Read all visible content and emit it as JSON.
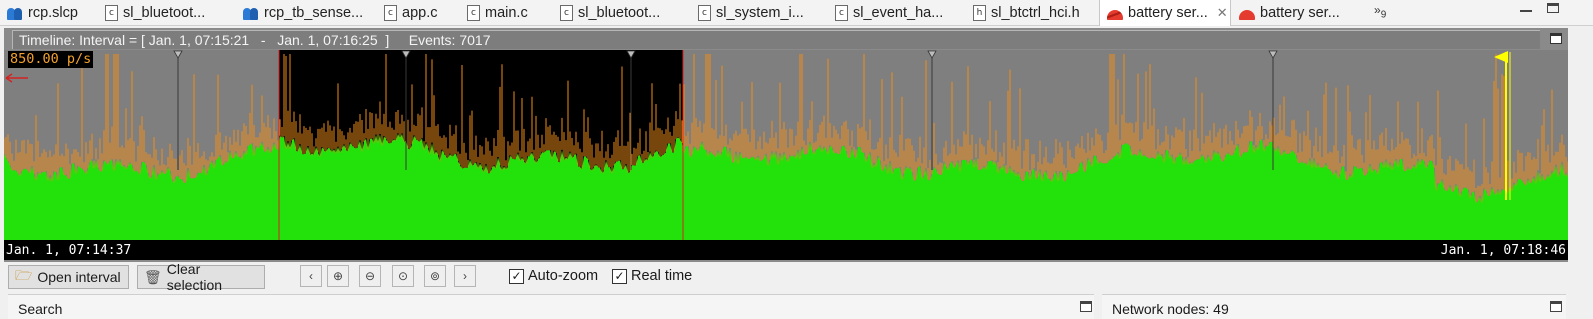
{
  "tabs": [
    {
      "label": "rcp.slcp",
      "icon": "project-icon",
      "active": false
    },
    {
      "label": "sl_bluetoot...",
      "icon": "c-file-icon",
      "active": false
    },
    {
      "label": "rcp_tb_sense...",
      "icon": "project-icon",
      "active": false
    },
    {
      "label": "app.c",
      "icon": "c-file-icon",
      "active": false
    },
    {
      "label": "main.c",
      "icon": "c-file-icon",
      "active": false
    },
    {
      "label": "sl_bluetoot...",
      "icon": "c-file-icon",
      "active": false
    },
    {
      "label": "sl_system_i...",
      "icon": "c-file-icon",
      "active": false
    },
    {
      "label": "sl_event_ha...",
      "icon": "c-file-icon",
      "active": false
    },
    {
      "label": "sl_btctrl_hci.h",
      "icon": "h-file-icon",
      "active": false
    },
    {
      "label": "battery ser...",
      "icon": "network-analyzer-icon",
      "active": true
    },
    {
      "label": "battery ser...",
      "icon": "network-analyzer-icon",
      "active": false
    }
  ],
  "tab_overflow_count": "9",
  "timeline": {
    "header": "Timeline: Interval = [ Jan. 1, 07:15:21   -   Jan. 1, 07:16:25  ]     Events: 7017",
    "rate_label": "850.00 p/s",
    "axis_start": "Jan. 1, 07:14:37",
    "axis_end": "Jan. 1, 07:18:46",
    "colors": {
      "background": "#7f7f7f",
      "selection": "#000000",
      "fill": "#23e10a",
      "peaks": "#ee8d1a",
      "marker": "#ffff00",
      "selection_edge": "#d42222"
    }
  },
  "toolbar": {
    "open_interval": "Open interval",
    "clear_selection": "Clear selection",
    "auto_zoom": "Auto-zoom",
    "real_time": "Real time",
    "auto_zoom_checked": true,
    "real_time_checked": true
  },
  "panels": {
    "search_title": "Search",
    "network_nodes": "Network nodes: 49"
  }
}
